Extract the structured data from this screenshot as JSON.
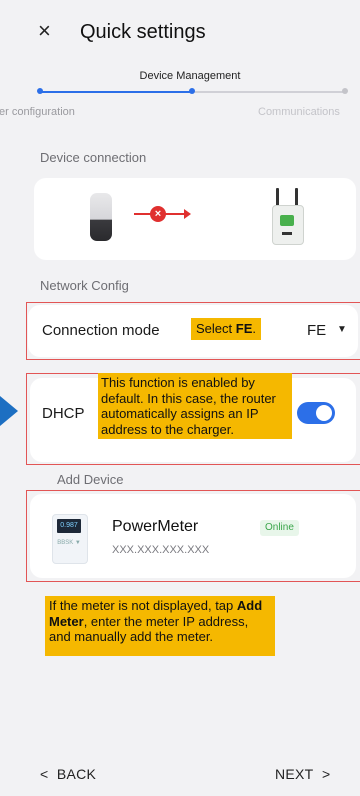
{
  "header": {
    "title": "Quick settings",
    "close_icon": "×"
  },
  "stepper": {
    "active_step": "Device Management",
    "prev_step": "ter configuration",
    "next_step": "Communications",
    "colors": {
      "active": "#2c6fe8",
      "inactive": "#d0d0d6"
    }
  },
  "device_connection": {
    "label": "Device connection",
    "status_icon": "×",
    "status_color": "#e0302f"
  },
  "network_config": {
    "label": "Network Config",
    "connection_mode": {
      "label": "Connection mode",
      "value": "FE",
      "dropdown_icon": "▼"
    },
    "dhcp": {
      "label": "DHCP",
      "enabled": true
    }
  },
  "callouts": {
    "select_prefix": "Select ",
    "select_bold": "FE",
    "select_suffix": ".",
    "dhcp_note": "This function is enabled by default. In this case, the router automatically assigns an IP address to the charger.",
    "meter_note_prefix": "If the meter is not displayed, tap ",
    "meter_note_bold": "Add Meter",
    "meter_note_suffix": ", enter the meter IP address, and manually add the meter.",
    "color": "#f5b800"
  },
  "add_device": {
    "label": "Add Device",
    "device": {
      "name": "PowerMeter",
      "status": "Online",
      "ip": "XXX.XXX.XXX.XXX",
      "icon_screen_text": "0.987",
      "icon_label_text": "BBSK ▼"
    }
  },
  "nav": {
    "back": "BACK",
    "back_icon": "<",
    "next": "NEXT",
    "next_icon": ">"
  }
}
